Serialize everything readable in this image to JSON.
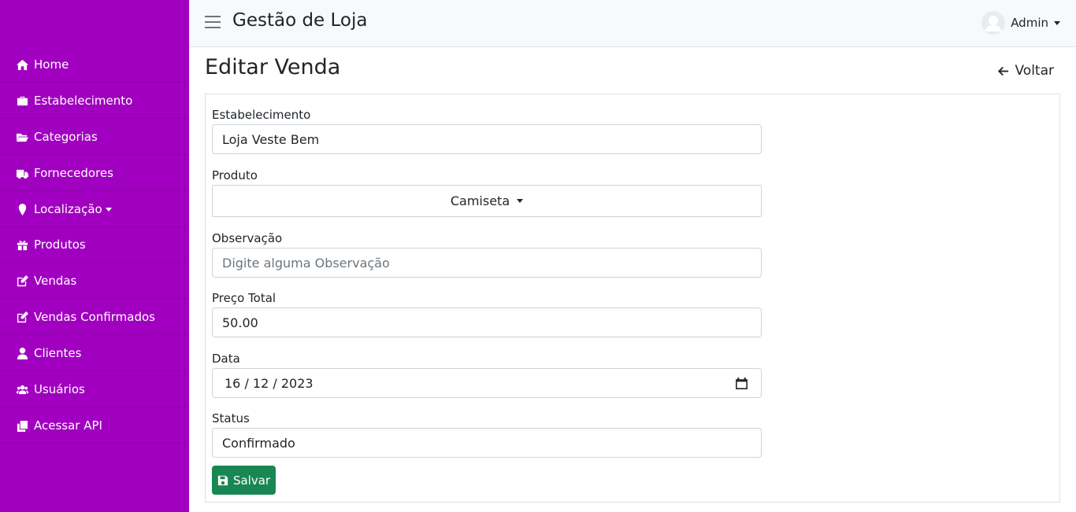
{
  "sidebar": {
    "bg_color": "#a100c0",
    "items": [
      {
        "label": "Home",
        "icon": "home-icon"
      },
      {
        "label": "Estabelecimento",
        "icon": "briefcase-icon"
      },
      {
        "label": "Categorias",
        "icon": "folder-open-icon"
      },
      {
        "label": "Fornecedores",
        "icon": "truck-icon"
      },
      {
        "label": "Localização",
        "icon": "map-marker-icon"
      },
      {
        "label": "Produtos",
        "icon": "gift-icon"
      },
      {
        "label": "Vendas",
        "icon": "edit-icon"
      },
      {
        "label": "Vendas Confirmados",
        "icon": "edit-icon"
      },
      {
        "label": "Clientes",
        "icon": "user-icon"
      },
      {
        "label": "Usuários",
        "icon": "users-icon"
      },
      {
        "label": "Acessar API",
        "icon": "copy-icon"
      }
    ]
  },
  "header": {
    "title": "Gestão de Loja",
    "user": "Admin"
  },
  "page": {
    "title": "Editar Venda",
    "back_label": "Voltar"
  },
  "form": {
    "estabelecimento": {
      "label": "Estabelecimento",
      "value": "Loja Veste Bem"
    },
    "produto": {
      "label": "Produto",
      "value": "Camiseta"
    },
    "observacao": {
      "label": "Observação",
      "value": "",
      "placeholder": "Digite alguma Observação"
    },
    "preco": {
      "label": "Preço Total",
      "value": "50.00"
    },
    "data": {
      "label": "Data",
      "value": "16 / 12 / 2023"
    },
    "status": {
      "label": "Status",
      "value": "Confirmado"
    },
    "save_label": "Salvar",
    "save_color": "#198754"
  }
}
